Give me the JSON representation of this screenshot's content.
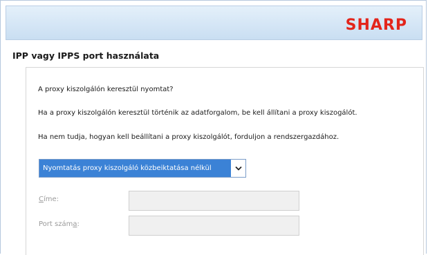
{
  "header": {
    "logo_text": "SHARP",
    "logo_color": "#e3251b"
  },
  "page": {
    "title": "IPP vagy IPPS port használata"
  },
  "content": {
    "question": "A proxy kiszolgálón keresztül nyomtat?",
    "info_1": "Ha a proxy kiszolgálón keresztül történik az adatforgalom, be kell állítani a proxy kiszogálót.",
    "info_2": "Ha nem tudja, hogyan kell beállítani a proxy kiszolgálót, forduljon a rendszergazdához."
  },
  "proxy_select": {
    "selected": "Nyomtatás proxy kiszolgáló közbeiktatása nélkül",
    "highlight_color": "#3b82d6",
    "arrow_icon": "chevron-down-icon"
  },
  "fields": {
    "address": {
      "label_accel": "C",
      "label_rest": "íme:",
      "value": ""
    },
    "port": {
      "label_pre": "Port szám",
      "label_accel": "a",
      "label_post": ":",
      "value": ""
    }
  }
}
